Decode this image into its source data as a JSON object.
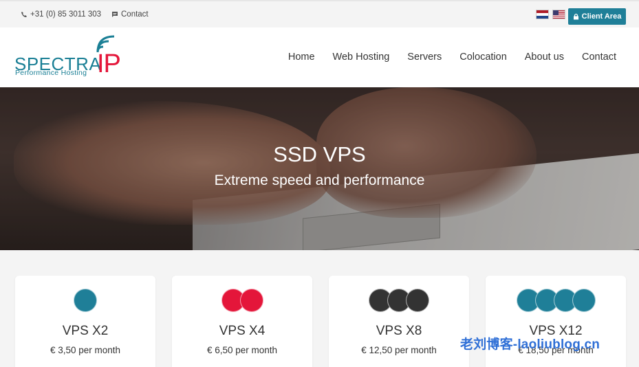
{
  "topbar": {
    "phone": "+31 (0) 85 3011 303",
    "contact": "Contact",
    "client_area": "Client Area"
  },
  "logo": {
    "main": "SPECTRA",
    "accent": "IP",
    "tagline": "Performance Hosting",
    "accent_color": "#e4163a",
    "brand_color": "#1a7f95"
  },
  "nav": [
    "Home",
    "Web Hosting",
    "Servers",
    "Colocation",
    "About us",
    "Contact"
  ],
  "hero": {
    "title": "SSD VPS",
    "subtitle": "Extreme speed and performance"
  },
  "plans": [
    {
      "name": "VPS X2",
      "price": "€ 3,50 per month",
      "dot_color": "#1f7f98",
      "dots": 1
    },
    {
      "name": "VPS X4",
      "price": "€ 6,50 per month",
      "dot_color": "#e4163a",
      "dots": 2
    },
    {
      "name": "VPS X8",
      "price": "€ 12,50 per month",
      "dot_color": "#333333",
      "dots": 3
    },
    {
      "name": "VPS X12",
      "price": "€ 18,50 per month",
      "dot_color": "#1f7f98",
      "dots": 4
    }
  ],
  "watermark": "老刘博客-laoliublog.cn"
}
